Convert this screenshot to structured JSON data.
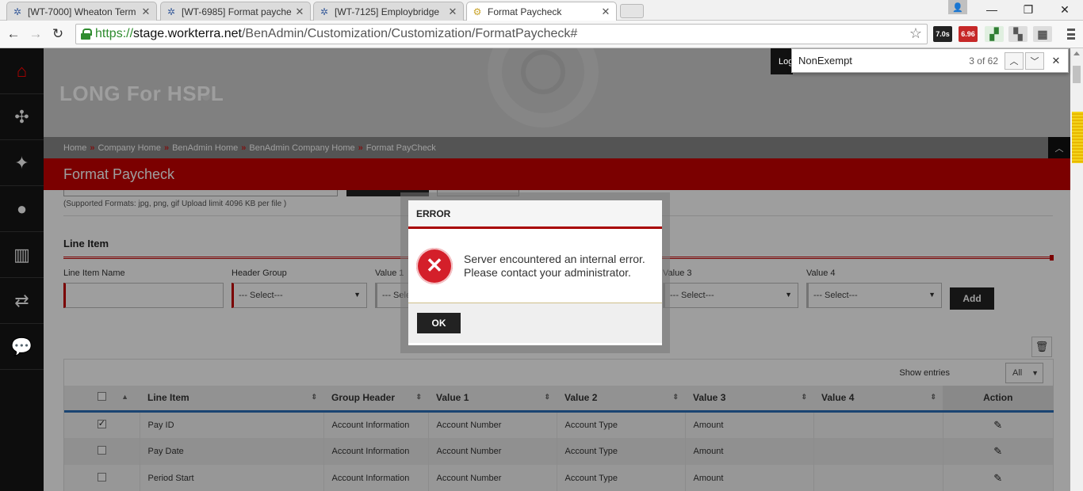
{
  "browser": {
    "tabs": [
      {
        "title": "[WT-7000] Wheaton Term",
        "icon": "jira-icon",
        "active": false
      },
      {
        "title": "[WT-6985] Format payche",
        "icon": "jira-icon",
        "active": false
      },
      {
        "title": "[WT-7125] Employbridge",
        "icon": "jira-icon",
        "active": false
      },
      {
        "title": "Format Paycheck",
        "icon": "gear-icon",
        "active": true
      }
    ],
    "url_scheme": "https://",
    "url_host": "stage.workterra.net",
    "url_path": "/BenAdmin/Customization/Customization/FormatPaycheck#",
    "ext_badge_1": "7.0s",
    "ext_badge_2": "6.96"
  },
  "find": {
    "query": "NonExempt",
    "count": "3 of 62"
  },
  "header": {
    "company": "LONG For HSPL",
    "logout_peek": "Log",
    "breadcrumbs": [
      "Home",
      "Company Home",
      "BenAdmin Home",
      "BenAdmin Company Home",
      "Format PayCheck"
    ],
    "breadcrumb_sep": "»",
    "page_title": "Format Paycheck"
  },
  "upload": {
    "hint": "(Supported Formats: jpg, png, gif Upload limit 4096 KB per file )"
  },
  "line_item": {
    "section_title": "Line Item",
    "labels": {
      "name": "Line Item Name",
      "header_group": "Header Group",
      "value1": "Value 1",
      "value3": "Value 3",
      "value4": "Value 4"
    },
    "select_placeholder": "--- Select---",
    "value1_partial": "--- Sele",
    "add_label": "Add"
  },
  "grid": {
    "show_entries_label": "Show entries",
    "show_entries_value": "All",
    "columns": [
      "Line Item",
      "Group Header",
      "Value 1",
      "Value 2",
      "Value 3",
      "Value 4",
      "Action"
    ],
    "rows": [
      {
        "checked": true,
        "line_item": "Pay ID",
        "group": "Account Information",
        "v1": "Account Number",
        "v2": "Account Type",
        "v3": "Amount",
        "v4": ""
      },
      {
        "checked": false,
        "line_item": "Pay Date",
        "group": "Account Information",
        "v1": "Account Number",
        "v2": "Account Type",
        "v3": "Amount",
        "v4": ""
      },
      {
        "checked": false,
        "line_item": "Period Start",
        "group": "Account Information",
        "v1": "Account Number",
        "v2": "Account Type",
        "v3": "Amount",
        "v4": ""
      }
    ]
  },
  "modal": {
    "title": "ERROR",
    "line1": "Server encountered an internal error.",
    "line2": "Please contact your administrator.",
    "ok_label": "OK"
  },
  "colors": {
    "brand_red": "#c70000",
    "error_red": "#d41f2a",
    "sidebar": "#0d0d0d"
  }
}
